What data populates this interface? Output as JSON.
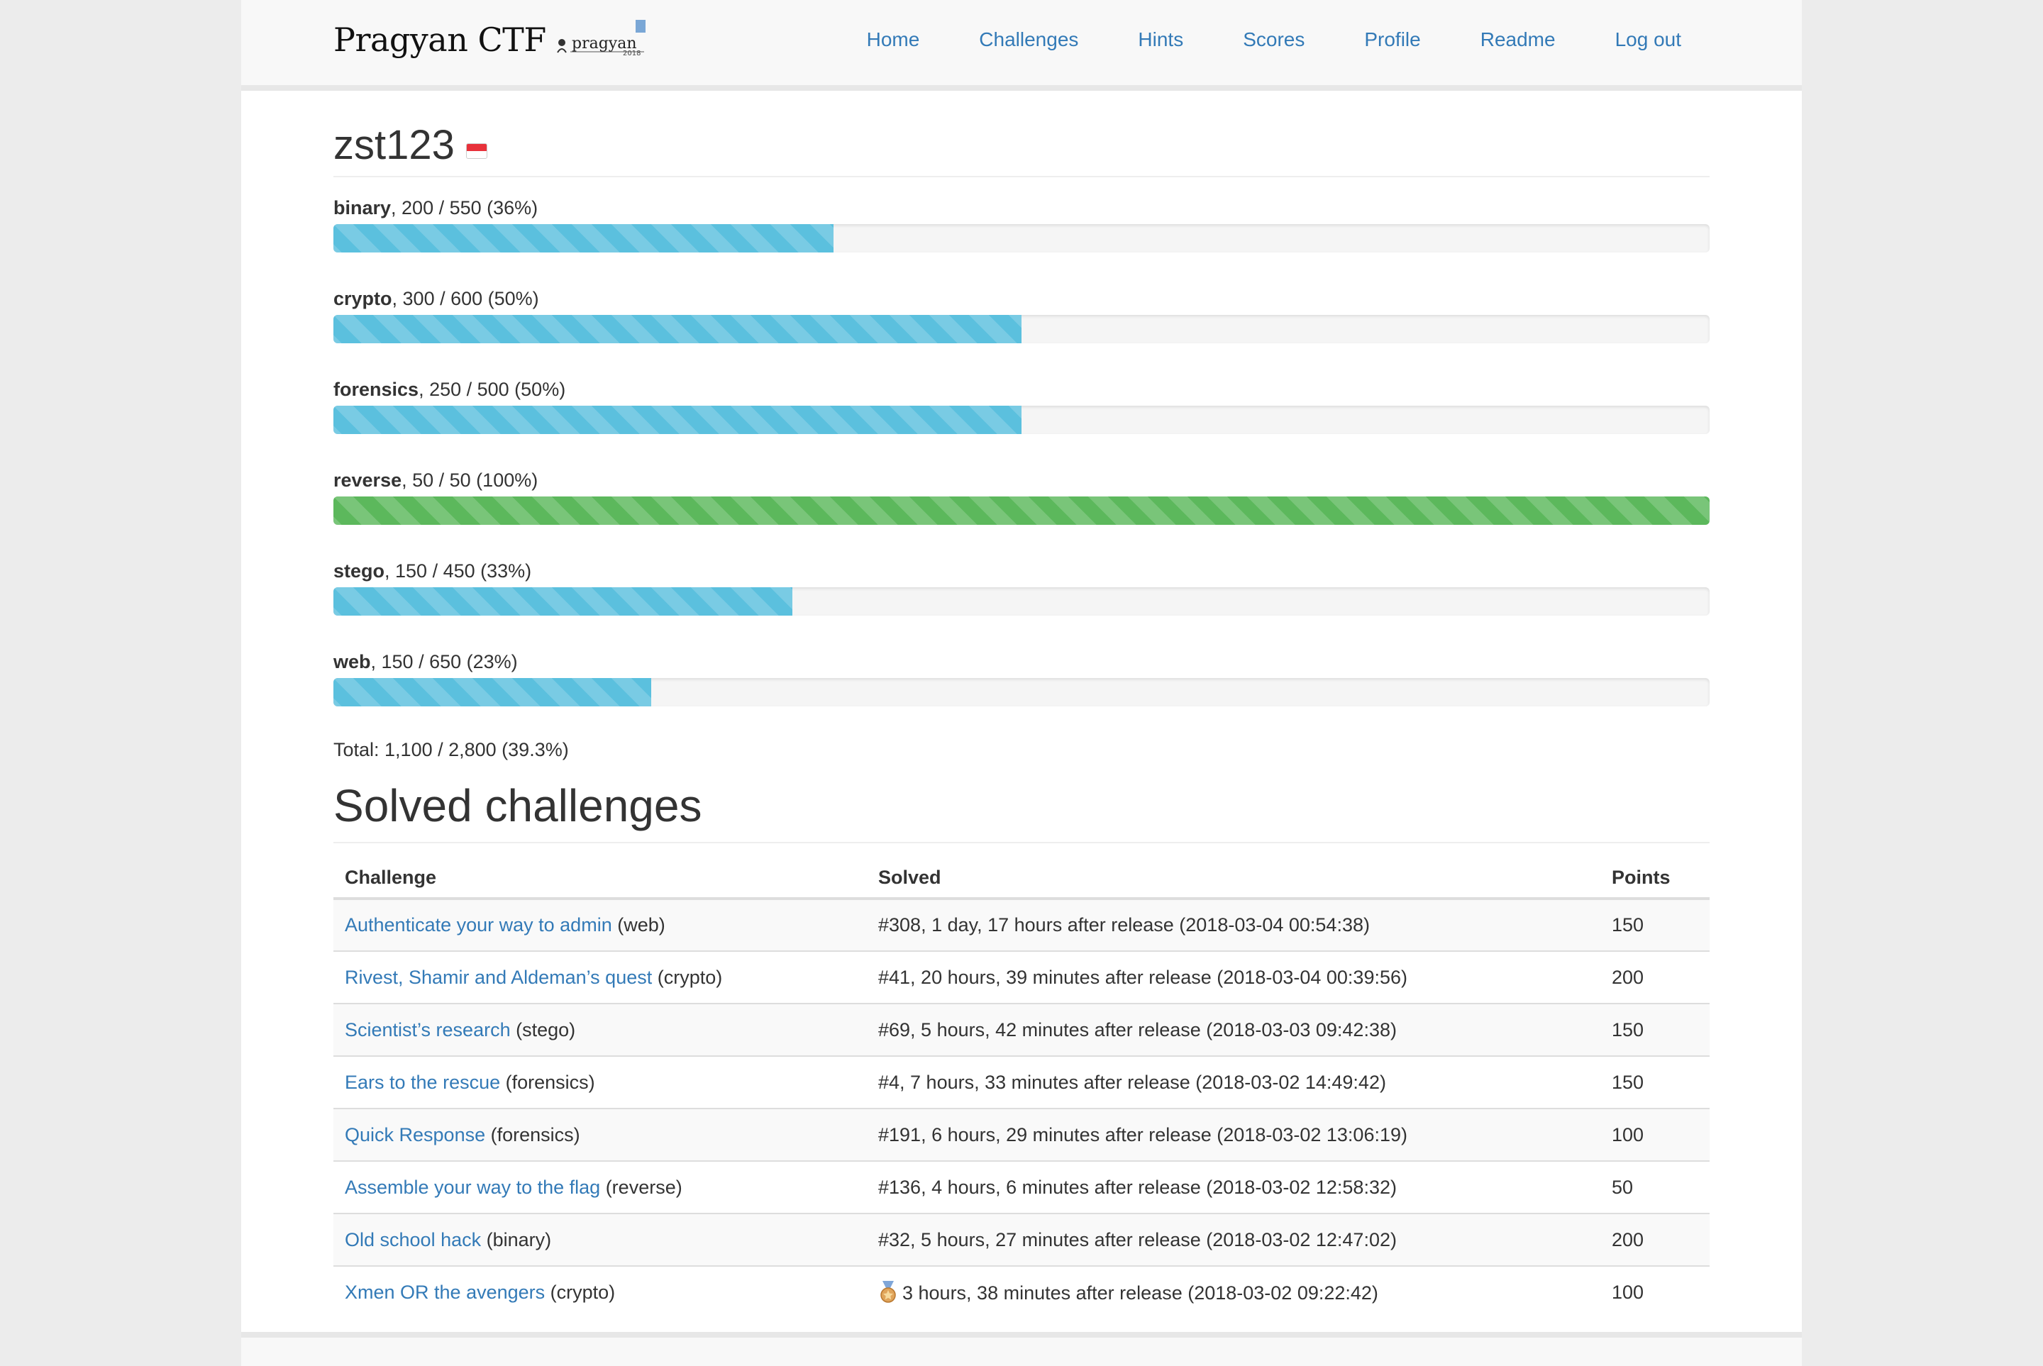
{
  "brand": {
    "title": "Pragyan CTF",
    "logo_text": "pragyan",
    "logo_year": "2018"
  },
  "nav": [
    {
      "label": "Home"
    },
    {
      "label": "Challenges"
    },
    {
      "label": "Hints"
    },
    {
      "label": "Scores"
    },
    {
      "label": "Profile"
    },
    {
      "label": "Readme"
    },
    {
      "label": "Log out"
    }
  ],
  "user": {
    "name": "zst123",
    "flag_icon": "flag-icon"
  },
  "categories": [
    {
      "name": "binary",
      "stats": ", 200 / 550 (36%)",
      "progress": 0.3636,
      "color": "#5bc0de"
    },
    {
      "name": "crypto",
      "stats": ", 300 / 600 (50%)",
      "progress": 0.5,
      "color": "#5bc0de"
    },
    {
      "name": "forensics",
      "stats": ", 250 / 500 (50%)",
      "progress": 0.5,
      "color": "#5bc0de"
    },
    {
      "name": "reverse",
      "stats": ", 50 / 50 (100%)",
      "progress": 1.0,
      "color": "#5cb85c"
    },
    {
      "name": "stego",
      "stats": ", 150 / 450 (33%)",
      "progress": 0.3333,
      "color": "#5bc0de"
    },
    {
      "name": "web",
      "stats": ", 150 / 650 (23%)",
      "progress": 0.2308,
      "color": "#5bc0de"
    }
  ],
  "total": "Total: 1,100 / 2,800 (39.3%)",
  "solved": {
    "title": "Solved challenges",
    "headers": {
      "challenge": "Challenge",
      "solved": "Solved",
      "points": "Points"
    },
    "rows": [
      {
        "name": "Authenticate your way to admin",
        "category": " (web)",
        "solved": "#308, 1 day, 17 hours after release (2018-03-04 00:54:38)",
        "points": "150"
      },
      {
        "name": "Rivest, Shamir and Aldeman’s quest",
        "category": " (crypto)",
        "solved": "#41, 20 hours, 39 minutes after release (2018-03-04 00:39:56)",
        "points": "200"
      },
      {
        "name": "Scientist’s research",
        "category": " (stego)",
        "solved": "#69, 5 hours, 42 minutes after release (2018-03-03 09:42:38)",
        "points": "150"
      },
      {
        "name": "Ears to the rescue",
        "category": " (forensics)",
        "solved": "#4, 7 hours, 33 minutes after release (2018-03-02 14:49:42)",
        "points": "150"
      },
      {
        "name": "Quick Response",
        "category": " (forensics)",
        "solved": "#191, 6 hours, 29 minutes after release (2018-03-02 13:06:19)",
        "points": "100"
      },
      {
        "name": "Assemble your way to the flag",
        "category": " (reverse)",
        "solved": "#136, 4 hours, 6 minutes after release (2018-03-02 12:58:32)",
        "points": "50"
      },
      {
        "name": "Old school hack",
        "category": " (binary)",
        "solved": "#32, 5 hours, 27 minutes after release (2018-03-02 12:47:02)",
        "points": "200"
      },
      {
        "name": "Xmen OR the avengers",
        "category": " (crypto)",
        "solved": "3 hours, 38 minutes after release (2018-03-02 09:22:42)",
        "points": "100",
        "medal": "medal-icon"
      }
    ]
  }
}
